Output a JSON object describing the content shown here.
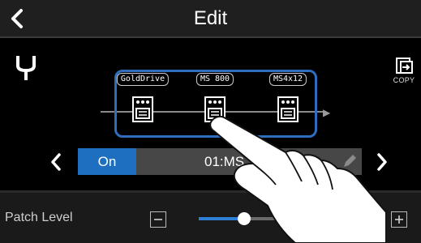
{
  "header": {
    "title": "Edit",
    "back_icon": "chevron-left-icon"
  },
  "toolbar": {
    "tuner_icon": "tuning-fork-icon",
    "copy_label": "COPY",
    "copy_icon": "copy-icon"
  },
  "effect_chain": {
    "effects": [
      {
        "name": "GoldDrive",
        "icon": "pedal-icon"
      },
      {
        "name": "MS 800",
        "icon": "pedal-icon"
      },
      {
        "name": "MS4x12",
        "icon": "pedal-icon"
      }
    ]
  },
  "patch_bar": {
    "on_label": "On",
    "patch_name": "01:MS",
    "prev_icon": "chevron-left-icon",
    "next_icon": "chevron-right-icon",
    "edit_icon": "pencil-icon"
  },
  "patch_level": {
    "label": "Patch Level",
    "value_fraction": 0.28,
    "minus_icon": "minus-icon",
    "plus_icon": "plus-icon"
  },
  "colors": {
    "accent": "#1e6fbf",
    "selection": "#2e6ebc"
  }
}
